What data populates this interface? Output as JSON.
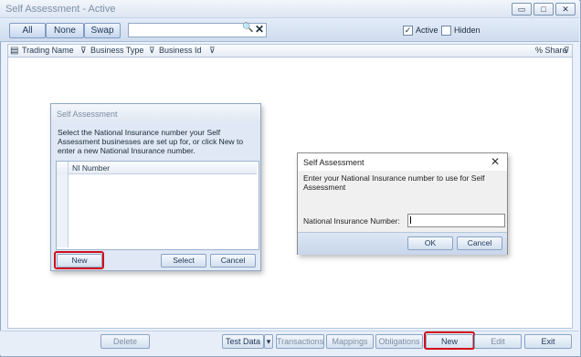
{
  "window": {
    "title": "Self Assessment - Active"
  },
  "window_controls": {
    "minimize": "▭",
    "restore": "□",
    "close": "✕"
  },
  "toolbar": {
    "filters": [
      "All",
      "None",
      "Swap"
    ],
    "search_value": "",
    "search_icon": "🔍",
    "clear_icon": "✕",
    "active_label": "Active",
    "active_checked": true,
    "hidden_label": "Hidden",
    "hidden_checked": false
  },
  "grid": {
    "columns": [
      "Trading Name",
      "Business Type",
      "Business Id",
      "% Share"
    ]
  },
  "bottom_buttons": {
    "delete": "Delete",
    "test_data": "Test Data",
    "dropdown": "▾",
    "transactions": "Transactions",
    "mappings": "Mappings",
    "obligations": "Obligations",
    "new": "New",
    "edit": "Edit",
    "exit": "Exit"
  },
  "dialog_select": {
    "title": "Self Assessment",
    "message": "Select the National Insurance number your Self Assessment businesses are set up for, or click New to enter a new National Insurance number.",
    "column": "NI Number",
    "new_label": "New",
    "select_label": "Select",
    "cancel_label": "Cancel"
  },
  "dialog_enter": {
    "title": "Self Assessment",
    "message": "Enter your National Insurance number to use for Self Assessment",
    "field_label": "National Insurance Number:",
    "field_value": "",
    "ok_label": "OK",
    "cancel_label": "Cancel",
    "close_icon": "✕"
  },
  "colors": {
    "highlight": "#d1101b",
    "accent": "#c6d7ee"
  }
}
